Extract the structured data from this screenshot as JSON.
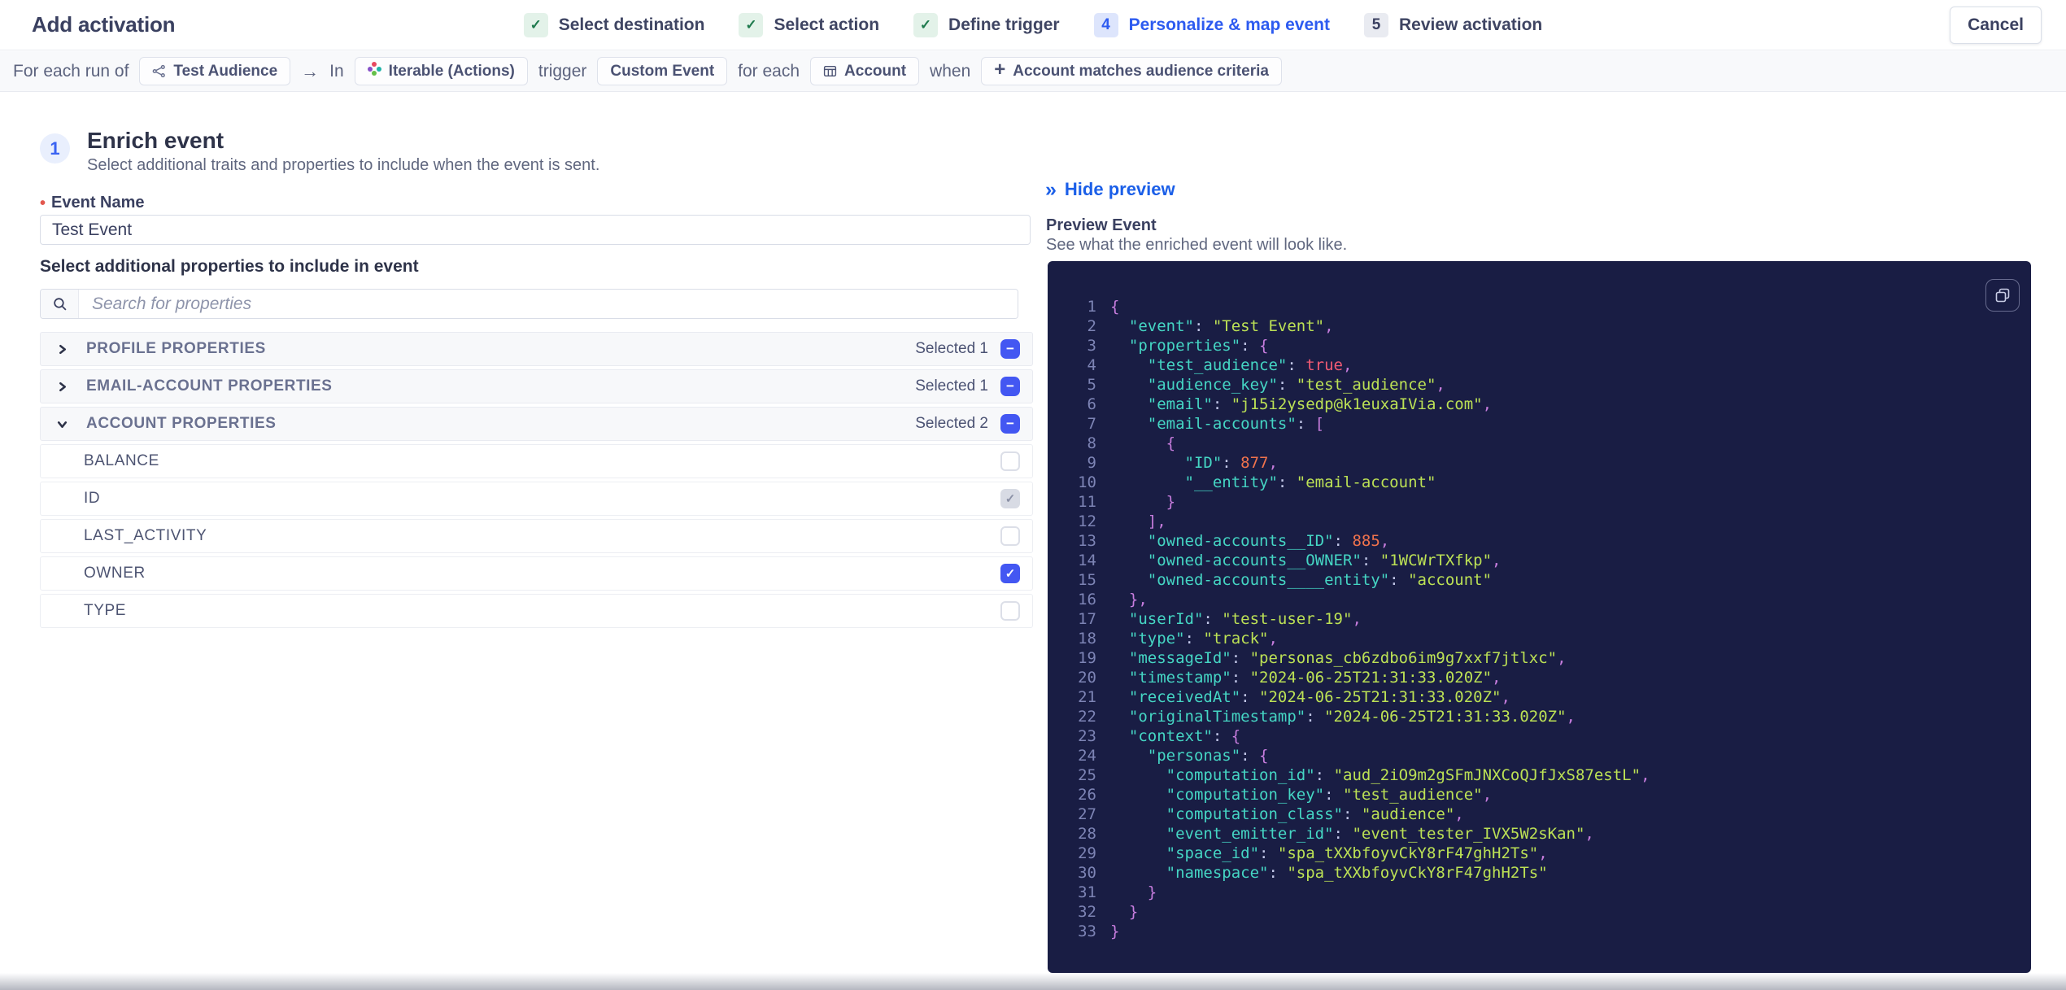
{
  "colors": {
    "accent_blue": "#4357f2",
    "link_blue": "#1b5fe8",
    "step_active_blue": "#2d5bf0",
    "success_green": "#1e7a4d",
    "code_panel_bg": "#191d44",
    "code_key": "#45d6c4",
    "code_string": "#bce155",
    "code_number": "#f0734d",
    "code_boolean": "#f25b74",
    "code_punctuation": "#c77dde"
  },
  "header": {
    "title": "Add activation",
    "cancel_label": "Cancel",
    "steps": [
      {
        "badge": "✓",
        "label": "Select destination",
        "state": "done"
      },
      {
        "badge": "✓",
        "label": "Select action",
        "state": "done"
      },
      {
        "badge": "✓",
        "label": "Define trigger",
        "state": "done"
      },
      {
        "badge": "4",
        "label": "Personalize & map event",
        "state": "active"
      },
      {
        "badge": "5",
        "label": "Review activation",
        "state": "upcoming"
      }
    ]
  },
  "breadcrumb": {
    "segments": [
      {
        "type": "text",
        "text": "For each run of"
      },
      {
        "type": "chip",
        "icon": "audience-icon",
        "label": "Test Audience"
      },
      {
        "type": "arrow",
        "text": "→"
      },
      {
        "type": "text",
        "text": "In"
      },
      {
        "type": "chip",
        "icon": "iterable-icon",
        "label": "Iterable (Actions)"
      },
      {
        "type": "text",
        "text": "trigger"
      },
      {
        "type": "chip",
        "label": "Custom Event"
      },
      {
        "type": "text",
        "text": "for each"
      },
      {
        "type": "chip",
        "icon": "table-icon",
        "label": "Account"
      },
      {
        "type": "text",
        "text": "when"
      },
      {
        "type": "chip",
        "icon": "plus-icon",
        "label": "Account matches audience criteria"
      }
    ]
  },
  "enrich": {
    "step_number": "1",
    "title": "Enrich event",
    "subtitle": "Select additional traits and properties to include when the event is sent.",
    "event_name_label": "Event Name",
    "required_marker": "•",
    "event_name_value": "Test Event",
    "properties_label": "Select additional properties to include in event",
    "search_placeholder": "Search for properties"
  },
  "groups": [
    {
      "label": "PROFILE PROPERTIES",
      "selected_label": "Selected 1",
      "chevron": "right",
      "checkbox": "indeterminate",
      "properties": []
    },
    {
      "label": "EMAIL-ACCOUNT PROPERTIES",
      "selected_label": "Selected 1",
      "chevron": "right",
      "checkbox": "indeterminate",
      "properties": []
    },
    {
      "label": "ACCOUNT PROPERTIES",
      "selected_label": "Selected 2",
      "chevron": "down",
      "checkbox": "indeterminate",
      "properties": [
        {
          "label": "BALANCE",
          "checkbox": "unchecked"
        },
        {
          "label": "ID",
          "checkbox": "checked-disabled"
        },
        {
          "label": "LAST_ACTIVITY",
          "checkbox": "unchecked"
        },
        {
          "label": "OWNER",
          "checkbox": "checked"
        },
        {
          "label": "TYPE",
          "checkbox": "unchecked"
        }
      ]
    }
  ],
  "preview": {
    "hide_glyph": "»",
    "hide_label": "Hide preview",
    "title": "Preview Event",
    "subtitle": "See what the enriched event will look like.",
    "code": {
      "lines": [
        {
          "n": 1,
          "t": [
            [
              "pun",
              "{"
            ]
          ]
        },
        {
          "n": 2,
          "t": [
            [
              "key",
              "  \"event\""
            ],
            [
              "col",
              ": "
            ],
            [
              "str",
              "\"Test Event\""
            ],
            [
              "pun",
              ","
            ]
          ]
        },
        {
          "n": 3,
          "t": [
            [
              "key",
              "  \"properties\""
            ],
            [
              "col",
              ": "
            ],
            [
              "pun",
              "{"
            ]
          ]
        },
        {
          "n": 4,
          "t": [
            [
              "key",
              "    \"test_audience\""
            ],
            [
              "col",
              ": "
            ],
            [
              "bool",
              "true"
            ],
            [
              "pun",
              ","
            ]
          ]
        },
        {
          "n": 5,
          "t": [
            [
              "key",
              "    \"audience_key\""
            ],
            [
              "col",
              ": "
            ],
            [
              "str",
              "\"test_audience\""
            ],
            [
              "pun",
              ","
            ]
          ]
        },
        {
          "n": 6,
          "t": [
            [
              "key",
              "    \"email\""
            ],
            [
              "col",
              ": "
            ],
            [
              "str",
              "\"j15i2ysedp@k1euxaIVia.com\""
            ],
            [
              "pun",
              ","
            ]
          ]
        },
        {
          "n": 7,
          "t": [
            [
              "key",
              "    \"email-accounts\""
            ],
            [
              "col",
              ": "
            ],
            [
              "pun",
              "["
            ]
          ]
        },
        {
          "n": 8,
          "t": [
            [
              "pun",
              "      {"
            ]
          ]
        },
        {
          "n": 9,
          "t": [
            [
              "key",
              "        \"ID\""
            ],
            [
              "col",
              ": "
            ],
            [
              "num",
              "877"
            ],
            [
              "pun",
              ","
            ]
          ]
        },
        {
          "n": 10,
          "t": [
            [
              "key",
              "        \"__entity\""
            ],
            [
              "col",
              ": "
            ],
            [
              "str",
              "\"email-account\""
            ]
          ]
        },
        {
          "n": 11,
          "t": [
            [
              "pun",
              "      }"
            ]
          ]
        },
        {
          "n": 12,
          "t": [
            [
              "pun",
              "    ],"
            ]
          ]
        },
        {
          "n": 13,
          "t": [
            [
              "key",
              "    \"owned-accounts__ID\""
            ],
            [
              "col",
              ": "
            ],
            [
              "num",
              "885"
            ],
            [
              "pun",
              ","
            ]
          ]
        },
        {
          "n": 14,
          "t": [
            [
              "key",
              "    \"owned-accounts__OWNER\""
            ],
            [
              "col",
              ": "
            ],
            [
              "str",
              "\"1WCWrTXfkp\""
            ],
            [
              "pun",
              ","
            ]
          ]
        },
        {
          "n": 15,
          "t": [
            [
              "key",
              "    \"owned-accounts____entity\""
            ],
            [
              "col",
              ": "
            ],
            [
              "str",
              "\"account\""
            ]
          ]
        },
        {
          "n": 16,
          "t": [
            [
              "pun",
              "  },"
            ]
          ]
        },
        {
          "n": 17,
          "t": [
            [
              "key",
              "  \"userId\""
            ],
            [
              "col",
              ": "
            ],
            [
              "str",
              "\"test-user-19\""
            ],
            [
              "pun",
              ","
            ]
          ]
        },
        {
          "n": 18,
          "t": [
            [
              "key",
              "  \"type\""
            ],
            [
              "col",
              ": "
            ],
            [
              "str",
              "\"track\""
            ],
            [
              "pun",
              ","
            ]
          ]
        },
        {
          "n": 19,
          "t": [
            [
              "key",
              "  \"messageId\""
            ],
            [
              "col",
              ": "
            ],
            [
              "str",
              "\"personas_cb6zdbo6im9g7xxf7jtlxc\""
            ],
            [
              "pun",
              ","
            ]
          ]
        },
        {
          "n": 20,
          "t": [
            [
              "key",
              "  \"timestamp\""
            ],
            [
              "col",
              ": "
            ],
            [
              "str",
              "\"2024-06-25T21:31:33.020Z\""
            ],
            [
              "pun",
              ","
            ]
          ]
        },
        {
          "n": 21,
          "t": [
            [
              "key",
              "  \"receivedAt\""
            ],
            [
              "col",
              ": "
            ],
            [
              "str",
              "\"2024-06-25T21:31:33.020Z\""
            ],
            [
              "pun",
              ","
            ]
          ]
        },
        {
          "n": 22,
          "t": [
            [
              "key",
              "  \"originalTimestamp\""
            ],
            [
              "col",
              ": "
            ],
            [
              "str",
              "\"2024-06-25T21:31:33.020Z\""
            ],
            [
              "pun",
              ","
            ]
          ]
        },
        {
          "n": 23,
          "t": [
            [
              "key",
              "  \"context\""
            ],
            [
              "col",
              ": "
            ],
            [
              "pun",
              "{"
            ]
          ]
        },
        {
          "n": 24,
          "t": [
            [
              "key",
              "    \"personas\""
            ],
            [
              "col",
              ": "
            ],
            [
              "pun",
              "{"
            ]
          ]
        },
        {
          "n": 25,
          "t": [
            [
              "key",
              "      \"computation_id\""
            ],
            [
              "col",
              ": "
            ],
            [
              "str",
              "\"aud_2iO9m2gSFmJNXCoQJfJxS87estL\""
            ],
            [
              "pun",
              ","
            ]
          ]
        },
        {
          "n": 26,
          "t": [
            [
              "key",
              "      \"computation_key\""
            ],
            [
              "col",
              ": "
            ],
            [
              "str",
              "\"test_audience\""
            ],
            [
              "pun",
              ","
            ]
          ]
        },
        {
          "n": 27,
          "t": [
            [
              "key",
              "      \"computation_class\""
            ],
            [
              "col",
              ": "
            ],
            [
              "str",
              "\"audience\""
            ],
            [
              "pun",
              ","
            ]
          ]
        },
        {
          "n": 28,
          "t": [
            [
              "key",
              "      \"event_emitter_id\""
            ],
            [
              "col",
              ": "
            ],
            [
              "str",
              "\"event_tester_IVX5W2sKan\""
            ],
            [
              "pun",
              ","
            ]
          ]
        },
        {
          "n": 29,
          "t": [
            [
              "key",
              "      \"space_id\""
            ],
            [
              "col",
              ": "
            ],
            [
              "str",
              "\"spa_tXXbfoyvCkY8rF47ghH2Ts\""
            ],
            [
              "pun",
              ","
            ]
          ]
        },
        {
          "n": 30,
          "t": [
            [
              "key",
              "      \"namespace\""
            ],
            [
              "col",
              ": "
            ],
            [
              "str",
              "\"spa_tXXbfoyvCkY8rF47ghH2Ts\""
            ]
          ]
        },
        {
          "n": 31,
          "t": [
            [
              "pun",
              "    }"
            ]
          ]
        },
        {
          "n": 32,
          "t": [
            [
              "pun",
              "  }"
            ]
          ]
        },
        {
          "n": 33,
          "t": [
            [
              "pun",
              "}"
            ]
          ]
        }
      ]
    }
  }
}
